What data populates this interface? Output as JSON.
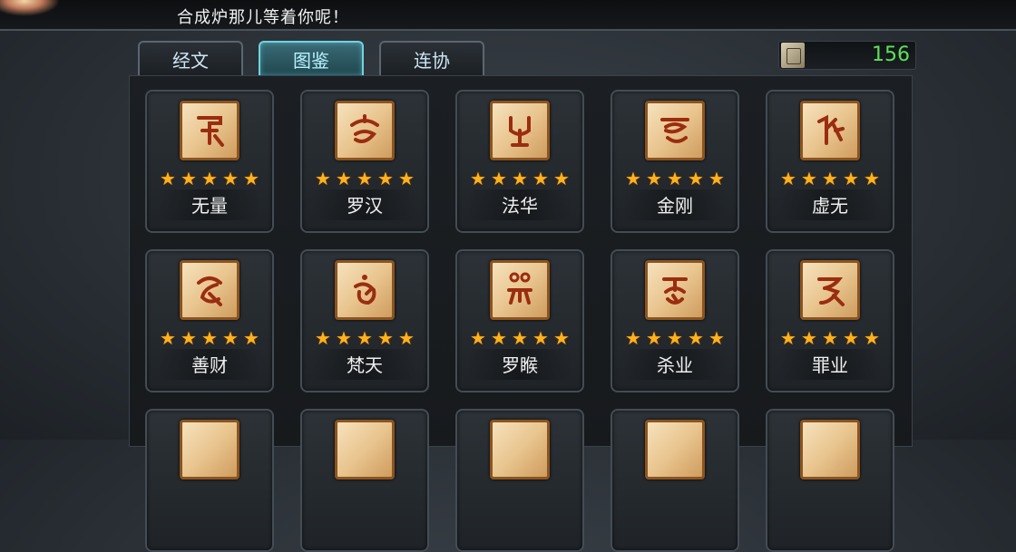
{
  "header": {
    "marquee": "合成炉那儿等着你呢！"
  },
  "tabs": [
    {
      "label": "经文",
      "active": false
    },
    {
      "label": "图鉴",
      "active": true
    },
    {
      "label": "连协",
      "active": false
    }
  ],
  "currency": {
    "icon": "scroll-icon",
    "value": "156"
  },
  "star_color": "#ffb21e",
  "cards": [
    {
      "name": "无量",
      "stars": 5
    },
    {
      "name": "罗汉",
      "stars": 5
    },
    {
      "name": "法华",
      "stars": 5
    },
    {
      "name": "金刚",
      "stars": 5
    },
    {
      "name": "虚无",
      "stars": 5
    },
    {
      "name": "善财",
      "stars": 5
    },
    {
      "name": "梵天",
      "stars": 5
    },
    {
      "name": "罗睺",
      "stars": 5
    },
    {
      "name": "杀业",
      "stars": 5
    },
    {
      "name": "罪业",
      "stars": 5
    },
    {
      "name": "",
      "stars": 0
    },
    {
      "name": "",
      "stars": 0
    },
    {
      "name": "",
      "stars": 0
    },
    {
      "name": "",
      "stars": 0
    },
    {
      "name": "",
      "stars": 0
    }
  ]
}
